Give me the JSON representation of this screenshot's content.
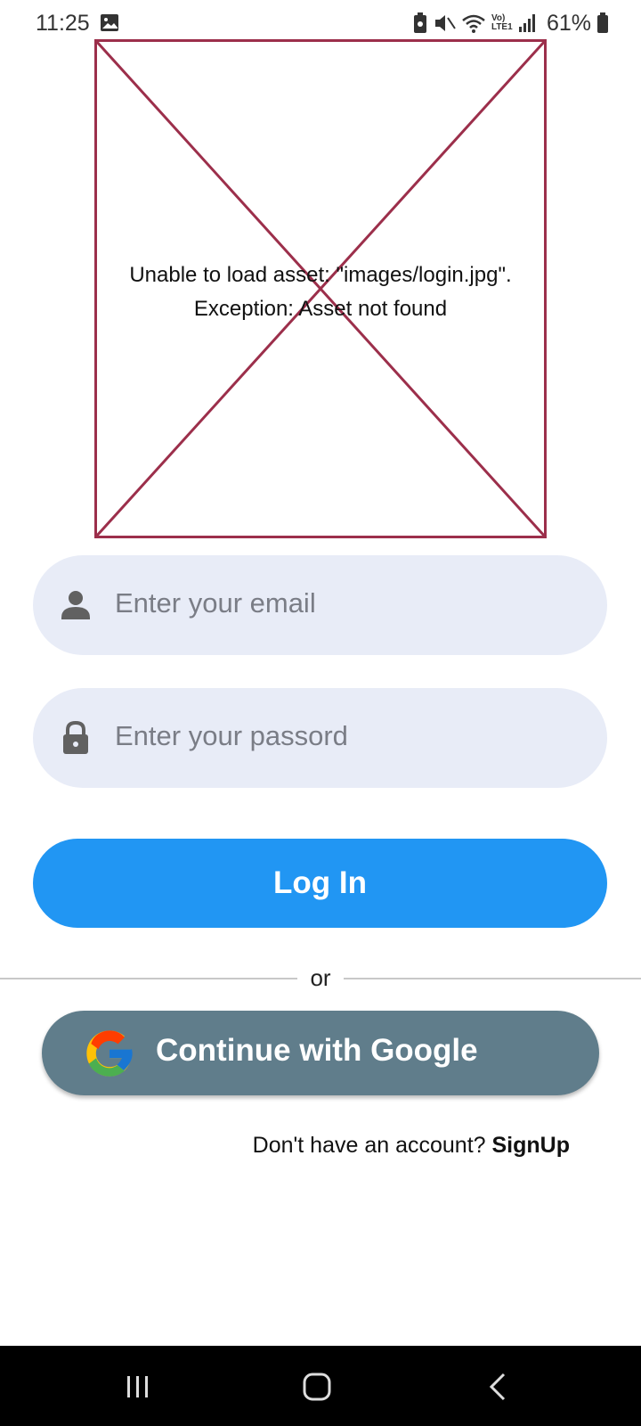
{
  "status_bar": {
    "time": "11:25",
    "battery_percent": "61%",
    "network_label": "Vo) LTE1"
  },
  "asset_placeholder": {
    "error_line1": "Unable to load asset: \"images/login.jpg\".",
    "error_line2": "Exception: Asset not found",
    "border_color": "#9c2f4b"
  },
  "form": {
    "email_placeholder": "Enter your email",
    "password_placeholder": "Enter your passord",
    "login_label": "Log In",
    "divider_text": "or",
    "google_label": "Continue with Google",
    "signup_prompt": "Don't have an account?",
    "signup_link": "SignUp"
  },
  "icons": {
    "email": "person-icon",
    "password": "lock-icon",
    "google": "google-icon"
  },
  "colors": {
    "primary": "#2196f3",
    "google_button": "#607d8b",
    "field_bg": "#e8ecf7"
  }
}
